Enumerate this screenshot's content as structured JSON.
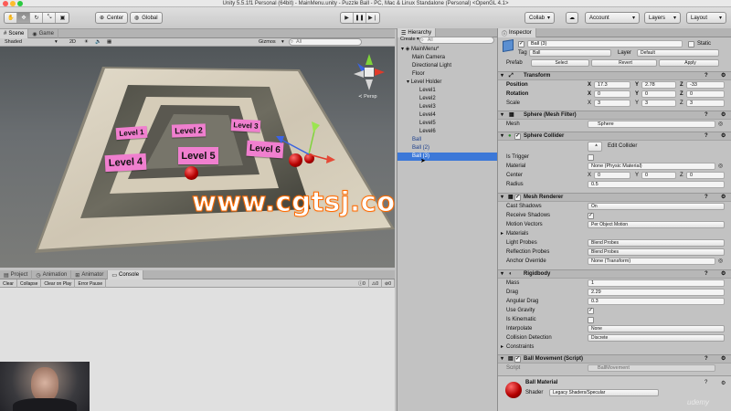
{
  "window": {
    "title": "Unity 5.5.1f1 Personal (64bit) - MainMenu.unity - Puzzle Ball - PC, Mac & Linux Standalone (Personal) <OpenGL 4.1>"
  },
  "toolbar": {
    "center_label": "Center",
    "global_label": "Global",
    "collab_label": "Collab",
    "account_label": "Account",
    "layers_label": "Layers",
    "layout_label": "Layout"
  },
  "scene": {
    "tab_scene": "Scene",
    "tab_game": "Game",
    "shading": "Shaded",
    "mode_2d": "2D",
    "gizmos": "Gizmos",
    "search_placeholder": "All",
    "persp": "Persp",
    "levels": [
      "Level 1",
      "Level 2",
      "Level 3",
      "Level 4",
      "Level 5",
      "Level 6"
    ],
    "watermark": "www.cgtsj.com"
  },
  "bottom": {
    "tab_project": "Project",
    "tab_animation": "Animation",
    "tab_animator": "Animator",
    "tab_console": "Console",
    "clear": "Clear",
    "collapse": "Collapse",
    "clear_on_play": "Clear on Play",
    "error_pause": "Error Pause",
    "count_log": "0",
    "count_warn": "0",
    "count_err": "0"
  },
  "hierarchy": {
    "tab": "Hierarchy",
    "create": "Create",
    "search_placeholder": "All",
    "items": [
      {
        "label": "MainMenu*"
      },
      {
        "label": "Main Camera"
      },
      {
        "label": "Directional Light"
      },
      {
        "label": "Floor"
      },
      {
        "label": "Level Holder"
      },
      {
        "label": "Level1"
      },
      {
        "label": "Level2"
      },
      {
        "label": "Level3"
      },
      {
        "label": "Level4"
      },
      {
        "label": "Level5"
      },
      {
        "label": "Level6"
      },
      {
        "label": "Ball"
      },
      {
        "label": "Ball (2)"
      },
      {
        "label": "Ball (3)"
      }
    ]
  },
  "inspector": {
    "tab": "Inspector",
    "object_name": "Ball (3)",
    "static_label": "Static",
    "tag_label": "Tag",
    "tag_value": "Ball",
    "layer_label": "Layer",
    "layer_value": "Default",
    "prefab_label": "Prefab",
    "prefab_select": "Select",
    "prefab_revert": "Revert",
    "prefab_apply": "Apply",
    "transform": {
      "title": "Transform",
      "position_label": "Position",
      "rotation_label": "Rotation",
      "scale_label": "Scale",
      "position": [
        "17.3",
        "2.78",
        "-33"
      ],
      "rotation": [
        "0",
        "0",
        "0"
      ],
      "scale": [
        "3",
        "3",
        "3"
      ],
      "axis_x": "X",
      "axis_y": "Y",
      "axis_z": "Z"
    },
    "mesh_filter": {
      "title": "Sphere (Mesh Filter)",
      "mesh_label": "Mesh",
      "mesh_value": "Sphere"
    },
    "collider": {
      "title": "Sphere Collider",
      "edit_label": "Edit Collider",
      "is_trigger_label": "Is Trigger",
      "material_label": "Material",
      "material_value": "None (Physic Material)",
      "center_label": "Center",
      "center": [
        "0",
        "0",
        "0"
      ],
      "radius_label": "Radius",
      "radius_value": "0.5"
    },
    "mesh_renderer": {
      "title": "Mesh Renderer",
      "cast_shadows_label": "Cast Shadows",
      "cast_shadows_value": "On",
      "receive_shadows_label": "Receive Shadows",
      "motion_vectors_label": "Motion Vectors",
      "motion_vectors_value": "Per Object Motion",
      "materials_label": "Materials",
      "light_probes_label": "Light Probes",
      "light_probes_value": "Blend Probes",
      "reflection_probes_label": "Reflection Probes",
      "reflection_probes_value": "Blend Probes",
      "anchor_label": "Anchor Override",
      "anchor_value": "None (Transform)"
    },
    "rigidbody": {
      "title": "Rigidbody",
      "mass_label": "Mass",
      "mass_value": "1",
      "drag_label": "Drag",
      "drag_value": "2.29",
      "angular_drag_label": "Angular Drag",
      "angular_drag_value": "0.3",
      "use_gravity_label": "Use Gravity",
      "is_kinematic_label": "Is Kinematic",
      "interpolate_label": "Interpolate",
      "interpolate_value": "None",
      "collision_label": "Collision Detection",
      "collision_value": "Discrete",
      "constraints_label": "Constraints"
    },
    "ball_movement": {
      "title": "Ball Movement (Script)",
      "script_label": "Script",
      "script_value": "BallMovement"
    },
    "material": {
      "title": "Ball Material",
      "shader_label": "Shader",
      "shader_value": "Legacy Shaders/Specular"
    }
  },
  "overlay": {
    "udemy": "udemy"
  },
  "colors": {
    "selection": "#3c78d8",
    "level_label": "#f07fcf",
    "ball": "#c40000",
    "watermark": "#ff6a00"
  }
}
